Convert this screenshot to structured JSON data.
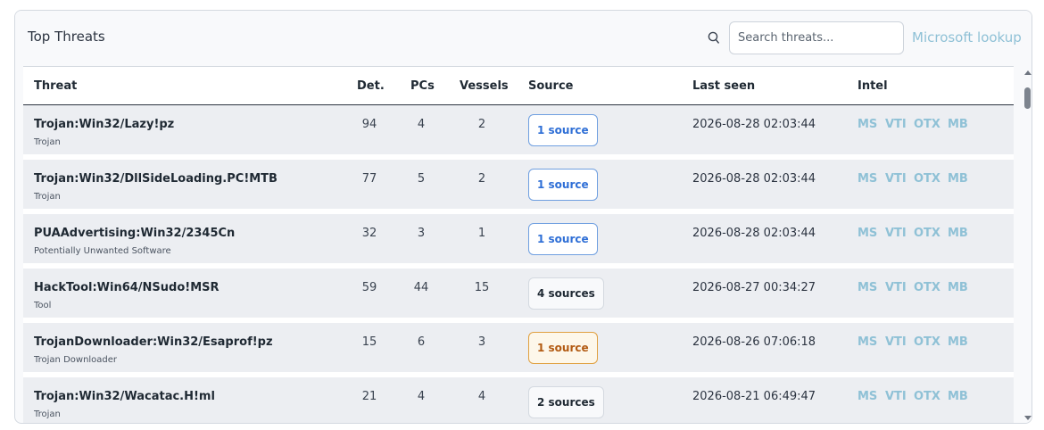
{
  "header": {
    "title": "Top Threats",
    "search_placeholder": "Search threats...",
    "search_value": "",
    "lookup_label": "Microsoft lookup"
  },
  "columns": {
    "threat": "Threat",
    "det": "Det.",
    "pcs": "PCs",
    "vessels": "Vessels",
    "source": "Source",
    "last_seen": "Last seen",
    "intel": "Intel"
  },
  "intel_links": [
    "MS",
    "VTI",
    "OTX",
    "MB"
  ],
  "colors": {
    "accent_link": "#8fc1d6",
    "badge_blue": "#2f6fd6",
    "badge_orange": "#b25a12",
    "badge_neutral": "#1f2933"
  },
  "rows": [
    {
      "name": "Trojan:Win32/Lazy!pz",
      "category": "Trojan",
      "det": "94",
      "pcs": "4",
      "vessels": "2",
      "source": "1 source",
      "source_style": "blue",
      "last_seen": "2026-08-28 02:03:44"
    },
    {
      "name": "Trojan:Win32/DllSideLoading.PC!MTB",
      "category": "Trojan",
      "det": "77",
      "pcs": "5",
      "vessels": "2",
      "source": "1 source",
      "source_style": "blue",
      "last_seen": "2026-08-28 02:03:44"
    },
    {
      "name": "PUAAdvertising:Win32/2345Cn",
      "category": "Potentially Unwanted Software",
      "det": "32",
      "pcs": "3",
      "vessels": "1",
      "source": "1 source",
      "source_style": "blue",
      "last_seen": "2026-08-28 02:03:44"
    },
    {
      "name": "HackTool:Win64/NSudo!MSR",
      "category": "Tool",
      "det": "59",
      "pcs": "44",
      "vessels": "15",
      "source": "4 sources",
      "source_style": "neutral",
      "last_seen": "2026-08-27 00:34:27"
    },
    {
      "name": "TrojanDownloader:Win32/Esaprof!pz",
      "category": "Trojan Downloader",
      "det": "15",
      "pcs": "6",
      "vessels": "3",
      "source": "1 source",
      "source_style": "orange",
      "last_seen": "2026-08-26 07:06:18"
    },
    {
      "name": "Trojan:Win32/Wacatac.H!ml",
      "category": "Trojan",
      "det": "21",
      "pcs": "4",
      "vessels": "4",
      "source": "2 sources",
      "source_style": "neutral",
      "last_seen": "2026-08-21 06:49:47"
    }
  ]
}
